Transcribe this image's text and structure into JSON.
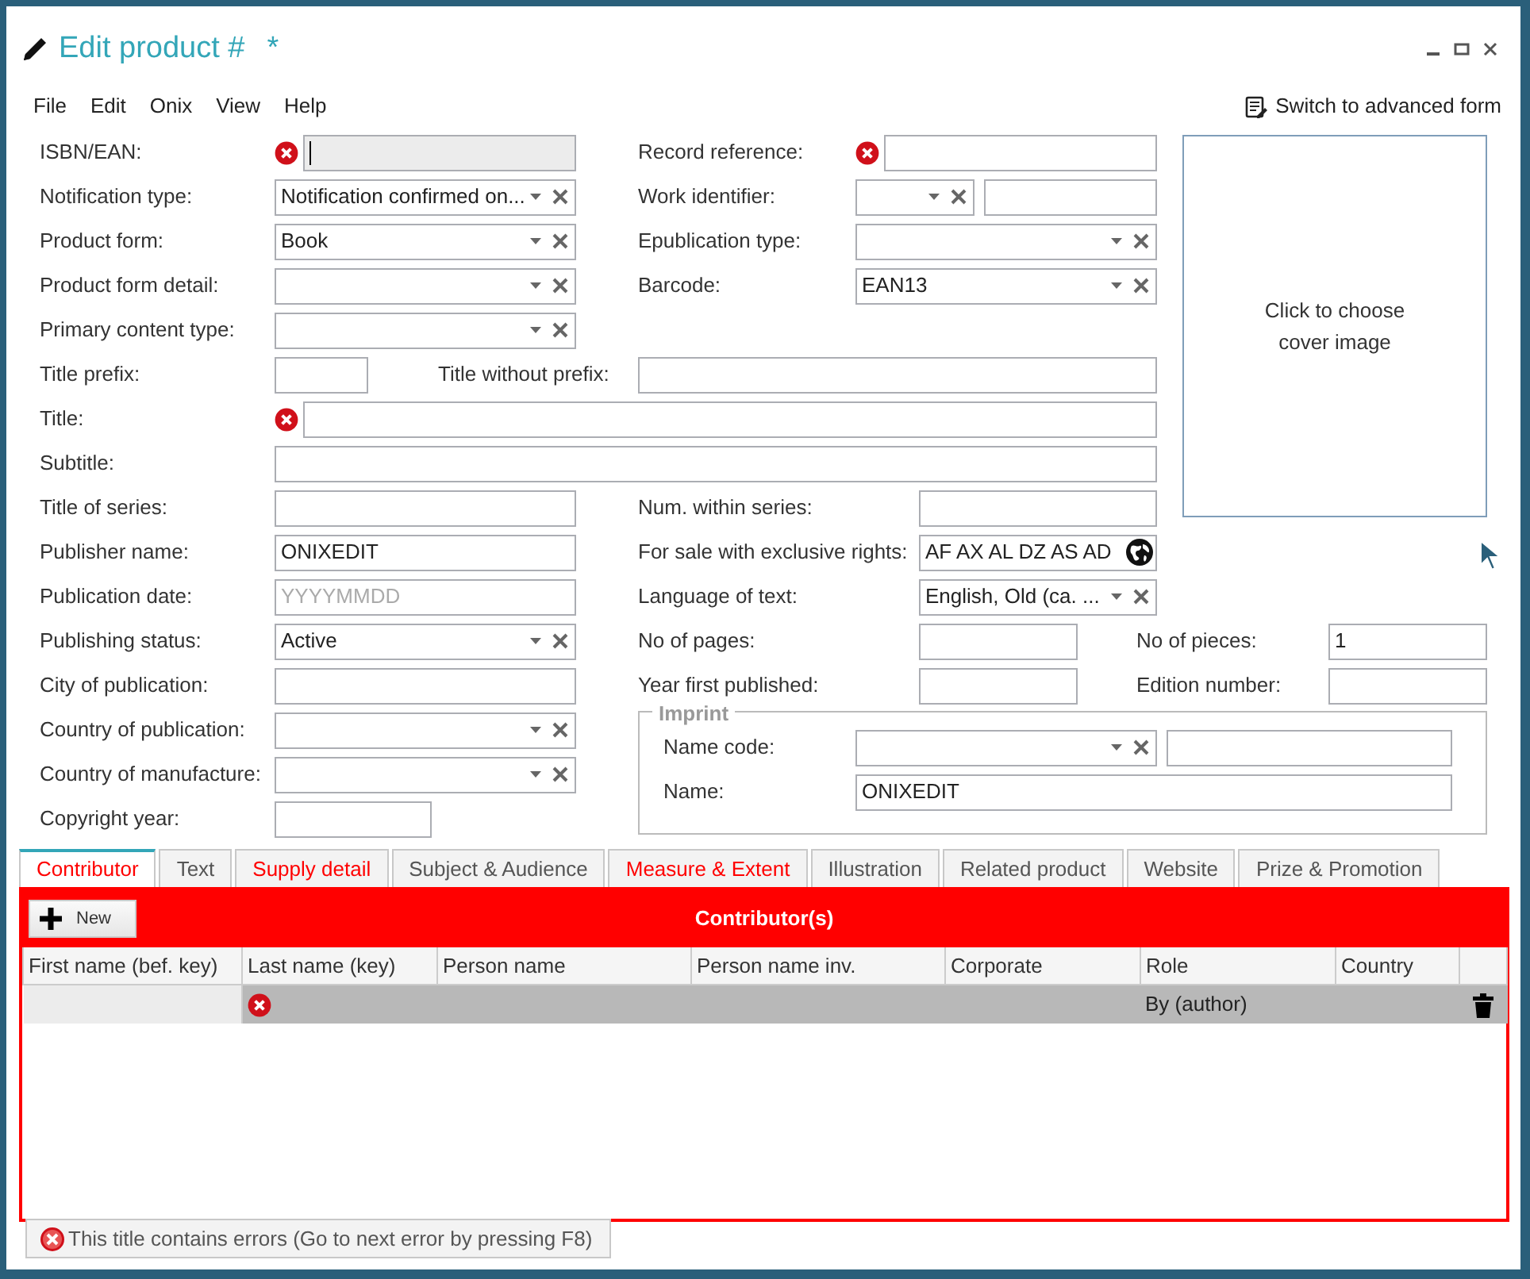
{
  "window": {
    "title": "Edit product #",
    "modified_mark": "*"
  },
  "menu": [
    "File",
    "Edit",
    "Onix",
    "View",
    "Help"
  ],
  "advanced_link": "Switch to advanced form",
  "form": [
    {
      "label": "ISBN/EAN:",
      "controls": [
        {
          "kind": "text",
          "error": true,
          "focused": true
        }
      ]
    },
    {
      "label": "Record reference:",
      "controls": [
        {
          "kind": "text",
          "error": true,
          "focused": false
        }
      ]
    },
    {
      "label": "Notification type:",
      "controls": [
        {
          "kind": "combo",
          "value": "Notification confirmed on...",
          "error": false,
          "focused": false
        }
      ]
    },
    {
      "label": "Work identifier:",
      "controls": [
        {
          "kind": "combo",
          "error": false,
          "focused": false
        },
        {
          "kind": "text",
          "error": false,
          "focused": false
        }
      ]
    },
    {
      "label": "Product form:",
      "controls": [
        {
          "kind": "combo",
          "value": "Book",
          "error": false,
          "focused": false
        }
      ]
    },
    {
      "label": "Epublication type:",
      "controls": [
        {
          "kind": "combo",
          "error": false,
          "focused": false
        }
      ]
    },
    {
      "label": "Product form detail:",
      "controls": [
        {
          "kind": "combo",
          "error": false,
          "focused": false
        }
      ]
    },
    {
      "label": "Barcode:",
      "controls": [
        {
          "kind": "combo",
          "value": "EAN13",
          "error": false,
          "focused": false
        }
      ]
    },
    {
      "label": "Primary content type:",
      "controls": [
        {
          "kind": "combo",
          "error": false,
          "focused": false
        }
      ]
    },
    {
      "label": "Title prefix:",
      "controls": [
        {
          "kind": "text",
          "error": false,
          "focused": false
        }
      ]
    },
    {
      "label": "Title without prefix:",
      "controls": [
        {
          "kind": "text",
          "error": false,
          "focused": false
        }
      ]
    },
    {
      "label": "Title:",
      "controls": [
        {
          "kind": "text",
          "error": true,
          "focused": false
        }
      ]
    },
    {
      "label": "Subtitle:",
      "controls": [
        {
          "kind": "text",
          "error": false,
          "focused": false
        }
      ]
    },
    {
      "label": "Title of series:",
      "controls": [
        {
          "kind": "text",
          "error": false,
          "focused": false
        }
      ]
    },
    {
      "label": "Num. within series:",
      "controls": [
        {
          "kind": "text",
          "error": false,
          "focused": false
        }
      ]
    },
    {
      "label": "Publisher name:",
      "controls": [
        {
          "kind": "text",
          "value": "ONIXEDIT",
          "error": false,
          "focused": false
        }
      ]
    },
    {
      "label": "For sale with exclusive rights:",
      "controls": [
        {
          "kind": "countries",
          "value": "AF AX AL DZ AS AD",
          "error": false,
          "focused": false
        }
      ]
    },
    {
      "label": "Publication date:",
      "controls": [
        {
          "kind": "text",
          "placeholder": "YYYYMMDD",
          "error": false,
          "focused": false
        }
      ]
    },
    {
      "label": "Language of text:",
      "controls": [
        {
          "kind": "combo",
          "value": "English, Old (ca. ...",
          "error": false,
          "focused": false
        }
      ]
    },
    {
      "label": "Publishing status:",
      "controls": [
        {
          "kind": "combo",
          "value": "Active",
          "error": false,
          "focused": false
        }
      ]
    },
    {
      "label": "No of pages:",
      "controls": [
        {
          "kind": "text",
          "error": false,
          "focused": false
        }
      ]
    },
    {
      "label": "No of pieces:",
      "controls": [
        {
          "kind": "text",
          "value": "1",
          "error": false,
          "focused": false
        }
      ]
    },
    {
      "label": "City of publication:",
      "controls": [
        {
          "kind": "text",
          "error": false,
          "focused": false
        }
      ]
    },
    {
      "label": "Year first published:",
      "controls": [
        {
          "kind": "text",
          "error": false,
          "focused": false
        }
      ]
    },
    {
      "label": "Edition number:",
      "controls": [
        {
          "kind": "text",
          "error": false,
          "focused": false
        }
      ]
    },
    {
      "label": "Country of publication:",
      "controls": [
        {
          "kind": "combo",
          "error": false,
          "focused": false
        }
      ]
    },
    {
      "label": "Country of manufacture:",
      "controls": [
        {
          "kind": "combo",
          "error": false,
          "focused": false
        }
      ]
    },
    {
      "label": "Copyright year:",
      "controls": [
        {
          "kind": "text",
          "error": false,
          "focused": false
        }
      ]
    }
  ],
  "cover": {
    "text": "Click to choose cover image"
  },
  "imprint": {
    "title": "Imprint",
    "items": [
      {
        "label": "Name code:",
        "controls": [
          {
            "kind": "combo",
            "error": false,
            "focused": false
          },
          {
            "kind": "text",
            "error": false,
            "focused": false
          }
        ]
      },
      {
        "label": "Name:",
        "controls": [
          {
            "kind": "text",
            "value": "ONIXEDIT",
            "error": false,
            "focused": false
          }
        ]
      }
    ]
  },
  "tabs": [
    {
      "label": "Contributor",
      "selected": true,
      "error": true
    },
    {
      "label": "Text",
      "selected": false,
      "error": false
    },
    {
      "label": "Supply detail",
      "selected": false,
      "error": true
    },
    {
      "label": "Subject & Audience",
      "selected": false,
      "error": false
    },
    {
      "label": "Measure & Extent",
      "selected": false,
      "error": true
    },
    {
      "label": "Illustration",
      "selected": false,
      "error": false
    },
    {
      "label": "Related product",
      "selected": false,
      "error": false
    },
    {
      "label": "Website",
      "selected": false,
      "error": false
    },
    {
      "label": "Prize & Promotion",
      "selected": false,
      "error": false
    }
  ],
  "contributors": {
    "title": "Contributor(s)",
    "error": true,
    "new_button": "New",
    "columns": [
      "First name (bef. key)",
      "Last name (key)",
      "Person name",
      "Person name inv.",
      "Corporate",
      "Role",
      "Country"
    ],
    "rows": [
      {
        "selected": true,
        "last_name_error": true,
        "role": "By (author)"
      }
    ]
  },
  "status": {
    "text": "This title contains errors (Go to next error by pressing F8)",
    "error": true
  }
}
